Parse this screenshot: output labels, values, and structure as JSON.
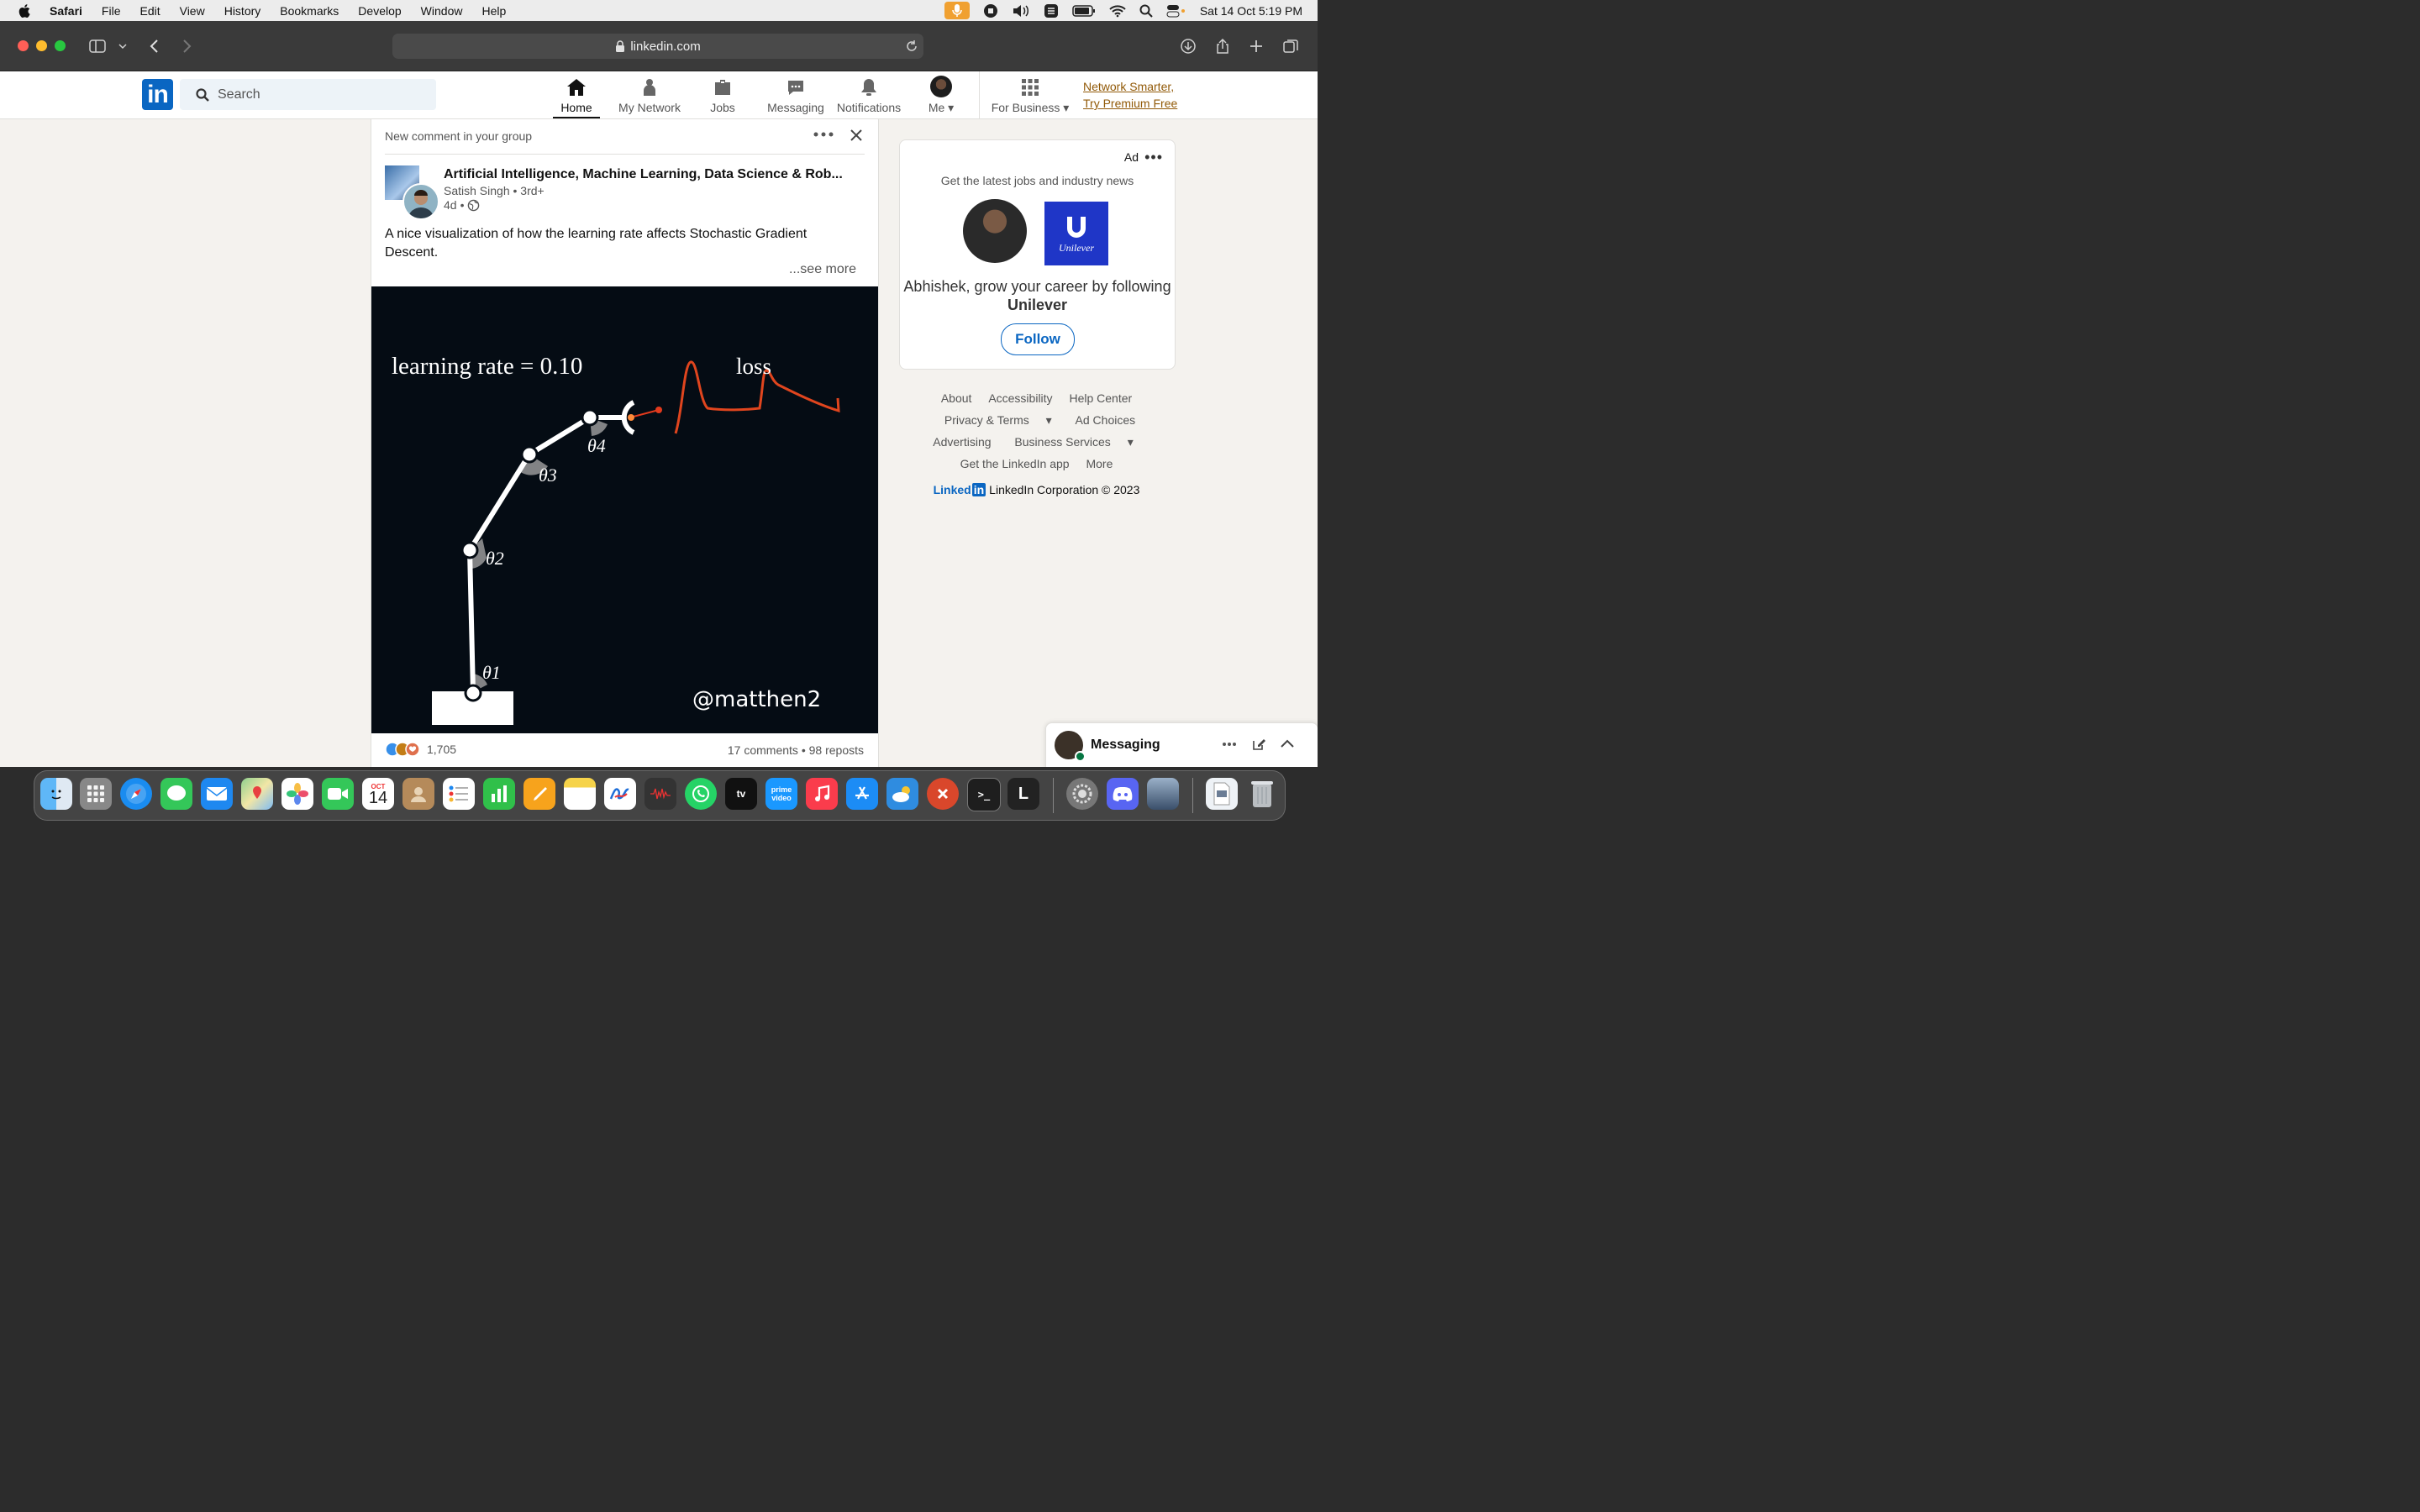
{
  "menubar": {
    "app": "Safari",
    "items": [
      "File",
      "Edit",
      "View",
      "History",
      "Bookmarks",
      "Develop",
      "Window",
      "Help"
    ],
    "datetime": "Sat 14 Oct  5:19 PM"
  },
  "browser": {
    "url": "linkedin.com"
  },
  "linkedin": {
    "search_placeholder": "Search",
    "nav": [
      "Home",
      "My Network",
      "Jobs",
      "Messaging",
      "Notifications",
      "Me",
      "For Business"
    ],
    "premium_line1": "Network Smarter,",
    "premium_line2": "Try Premium Free"
  },
  "post": {
    "header": "New comment in your group",
    "group": "Artificial Intelligence, Machine Learning, Data Science & Rob...",
    "author": "Satish Singh",
    "degree": "3rd+",
    "age": "4d",
    "text": "A nice visualization of how the learning rate affects Stochastic Gradient Descent.",
    "see_more": "...see more",
    "reaction_count": "1,705",
    "comments": "17 comments",
    "reposts": "98 reposts",
    "visual": {
      "learning_rate_label": "learning rate = 0.10",
      "loss_label": "loss",
      "theta1": "θ1",
      "theta2": "θ2",
      "theta3": "θ3",
      "theta4": "θ4",
      "watermark": "@matthen2"
    }
  },
  "ad": {
    "label": "Ad",
    "subtitle": "Get the latest jobs and industry news",
    "text": "Abhishek, grow your career by following",
    "company": "Unilever",
    "follow": "Follow",
    "brand_logo_text": "Unilever"
  },
  "footer": {
    "links": [
      "About",
      "Accessibility",
      "Help Center",
      "Privacy & Terms",
      "Ad Choices",
      "Advertising",
      "Business Services",
      "Get the LinkedIn app",
      "More"
    ],
    "brand": "Linked",
    "copyright": "LinkedIn Corporation © 2023"
  },
  "messaging": {
    "title": "Messaging"
  },
  "dock": {
    "calendar_month": "OCT",
    "calendar_day": "14",
    "prime": "prime video",
    "terminal": ">_",
    "l_app": "L"
  }
}
